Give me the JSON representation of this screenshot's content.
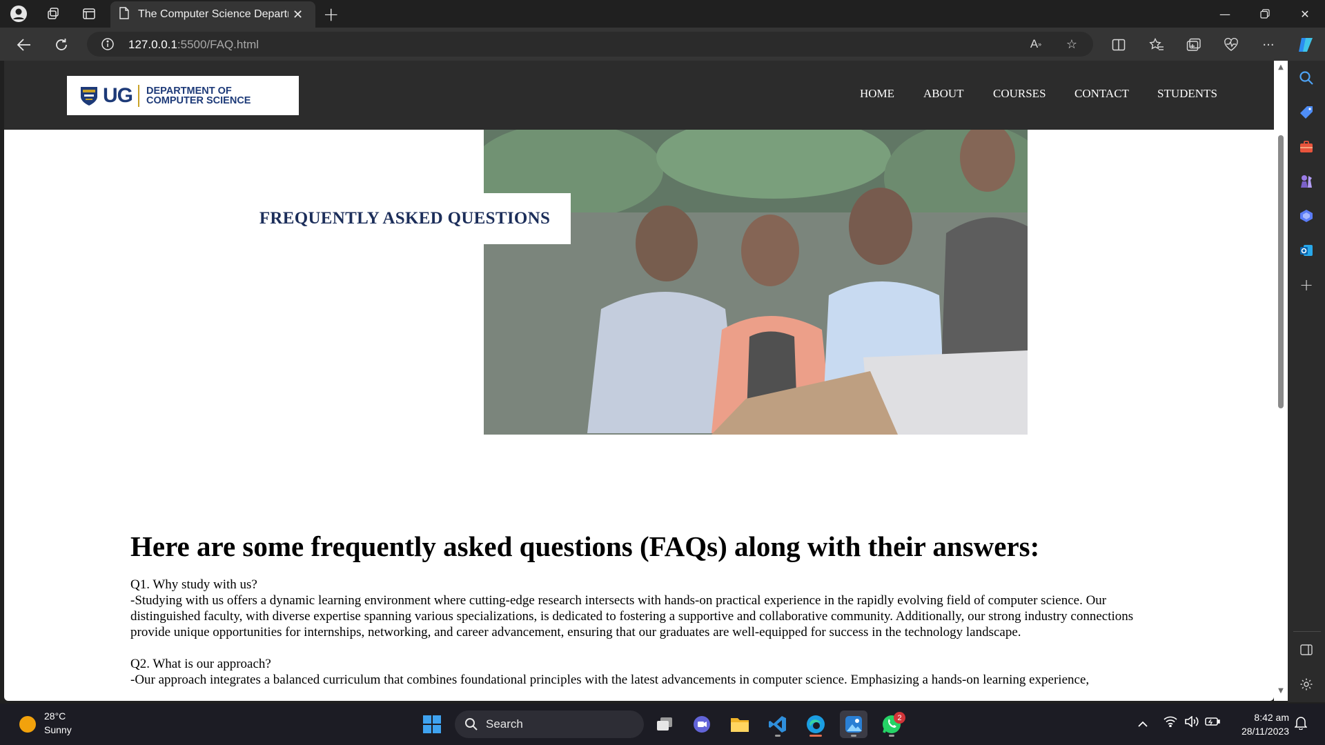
{
  "browser": {
    "tab_title": "The Computer Science Departme",
    "url_host": "127.0.0.1",
    "url_path": ":5500/FAQ.html"
  },
  "site": {
    "logo_ug": "UG",
    "logo_line1": "DEPARTMENT OF",
    "logo_line2": "COMPUTER SCIENCE",
    "nav": [
      "HOME",
      "ABOUT",
      "COURSES",
      "CONTACT",
      "STUDENTS"
    ],
    "hero_title": "FREQUENTLY ASKED QUESTIONS",
    "faq_heading": "Here are some frequently asked questions (FAQs) along with their answers:",
    "faqs": [
      {
        "q": "Q1. Why study with us?",
        "a": "-Studying with us offers a dynamic learning environment where cutting-edge research intersects with hands-on practical experience in the rapidly evolving field of computer science. Our distinguished faculty, with diverse expertise spanning various specializations, is dedicated to fostering a supportive and collaborative community. Additionally, our strong industry connections provide unique opportunities for internships, networking, and career advancement, ensuring that our graduates are well-equipped for success in the technology landscape."
      },
      {
        "q": "Q2. What is our approach?",
        "a": "-Our approach integrates a balanced curriculum that combines foundational principles with the latest advancements in computer science. Emphasizing a hands-on learning experience,"
      }
    ]
  },
  "taskbar": {
    "temp": "28°C",
    "weather": "Sunny",
    "search_label": "Search",
    "whatsapp_badge": "2",
    "time": "8:42 am",
    "date": "28/11/2023"
  },
  "colors": {
    "header_bg": "#2c2c2c",
    "brand_blue": "#1d3a78",
    "hero_title": "#1c2e5a"
  }
}
